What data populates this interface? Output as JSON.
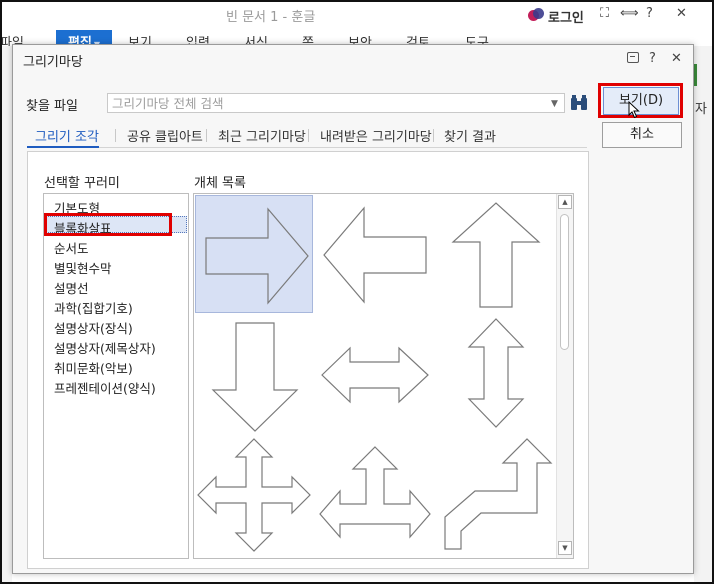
{
  "app": {
    "title": "빈 문서 1 - 훈글",
    "login_label": "로그인",
    "window_controls": [
      "⛶",
      "⟺",
      "?",
      "✕"
    ],
    "menu": [
      "파일",
      "편집",
      "보기",
      "입력",
      "서식",
      "쪽",
      "보안",
      "검토",
      "도구"
    ],
    "active_menu": "편집",
    "right_edge_text": "자"
  },
  "dialog": {
    "title": "그리기마당",
    "controls": {
      "help": "?",
      "close": "✕"
    },
    "search": {
      "label": "찾을 파일",
      "placeholder": "그리기마당 전체 검색"
    },
    "buttons": {
      "view": "보기(D)",
      "cancel": "취소"
    },
    "tabs": [
      "그리기 조각",
      "공유 클립아트",
      "최근 그리기마당",
      "내려받은 그리기마당",
      "찾기 결과"
    ],
    "active_tab": "그리기 조각",
    "categories_title": "선택할 꾸러미",
    "categories": [
      "기본도형",
      "블록화살표",
      "순서도",
      "별및현수막",
      "설명선",
      "과학(집합기호)",
      "설명상자(장식)",
      "설명상자(제목상자)",
      "취미문화(악보)",
      "프레젠테이션(양식)"
    ],
    "selected_category": "블록화살표",
    "objects_title": "개체 목록",
    "objects": [
      "right-arrow-shape",
      "left-arrow-shape",
      "up-arrow-shape",
      "down-arrow-shape",
      "left-right-arrow-shape",
      "up-down-arrow-shape",
      "quad-arrow-shape",
      "left-right-up-arrow-shape",
      "bent-up-arrow-shape"
    ],
    "selected_object": "right-arrow-shape"
  },
  "colors": {
    "accent": "#1c6fd1",
    "highlight_box": "#e00000",
    "selection_bg": "#d7e0f4"
  }
}
